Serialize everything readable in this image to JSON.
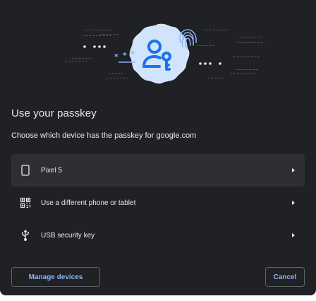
{
  "dialog": {
    "title": "Use your passkey",
    "subtitle": "Choose which device has the passkey for google.com"
  },
  "devices": [
    {
      "label": "Pixel 5",
      "icon": "phone-icon",
      "selected": true
    },
    {
      "label": "Use a different phone or tablet",
      "icon": "qr-code-icon",
      "selected": false
    },
    {
      "label": "USB security key",
      "icon": "usb-icon",
      "selected": false
    }
  ],
  "actions": {
    "manage_label": "Manage devices",
    "cancel_label": "Cancel"
  },
  "colors": {
    "background": "#202124",
    "accent": "#8ab4f8",
    "illustration_blob": "#d2e3fc",
    "illustration_icon": "#1a73e8"
  }
}
